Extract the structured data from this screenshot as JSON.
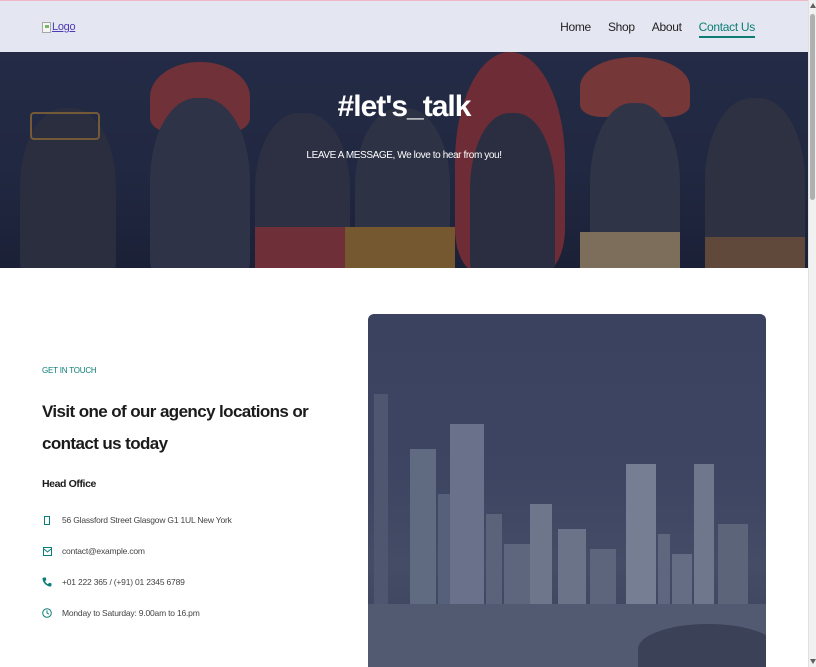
{
  "header": {
    "logo_alt": "Logo",
    "nav": [
      {
        "label": "Home"
      },
      {
        "label": "Shop"
      },
      {
        "label": "About"
      },
      {
        "label": "Contact Us",
        "active": true
      }
    ]
  },
  "hero": {
    "title": "#let's_talk",
    "subtitle": "LEAVE A MESSAGE, We love to hear from you!"
  },
  "contact": {
    "eyebrow": "GET IN TOUCH",
    "heading": "Visit one of our agency locations or contact us today",
    "office_title": "Head Office",
    "items": [
      {
        "icon": "map-marker-icon",
        "text": "56 Glassford Street Glasgow G1 1UL New York"
      },
      {
        "icon": "envelope-icon",
        "text": "contact@example.com"
      },
      {
        "icon": "phone-icon",
        "text": "+01 222 365 / (+91) 01 2345 6789"
      },
      {
        "icon": "clock-icon",
        "text": "Monday to Saturday: 9.00am to 16.pm"
      }
    ]
  },
  "colors": {
    "accent": "#0c7d75",
    "header_bg": "#e4e7f2",
    "hero_bg": "#283049"
  }
}
